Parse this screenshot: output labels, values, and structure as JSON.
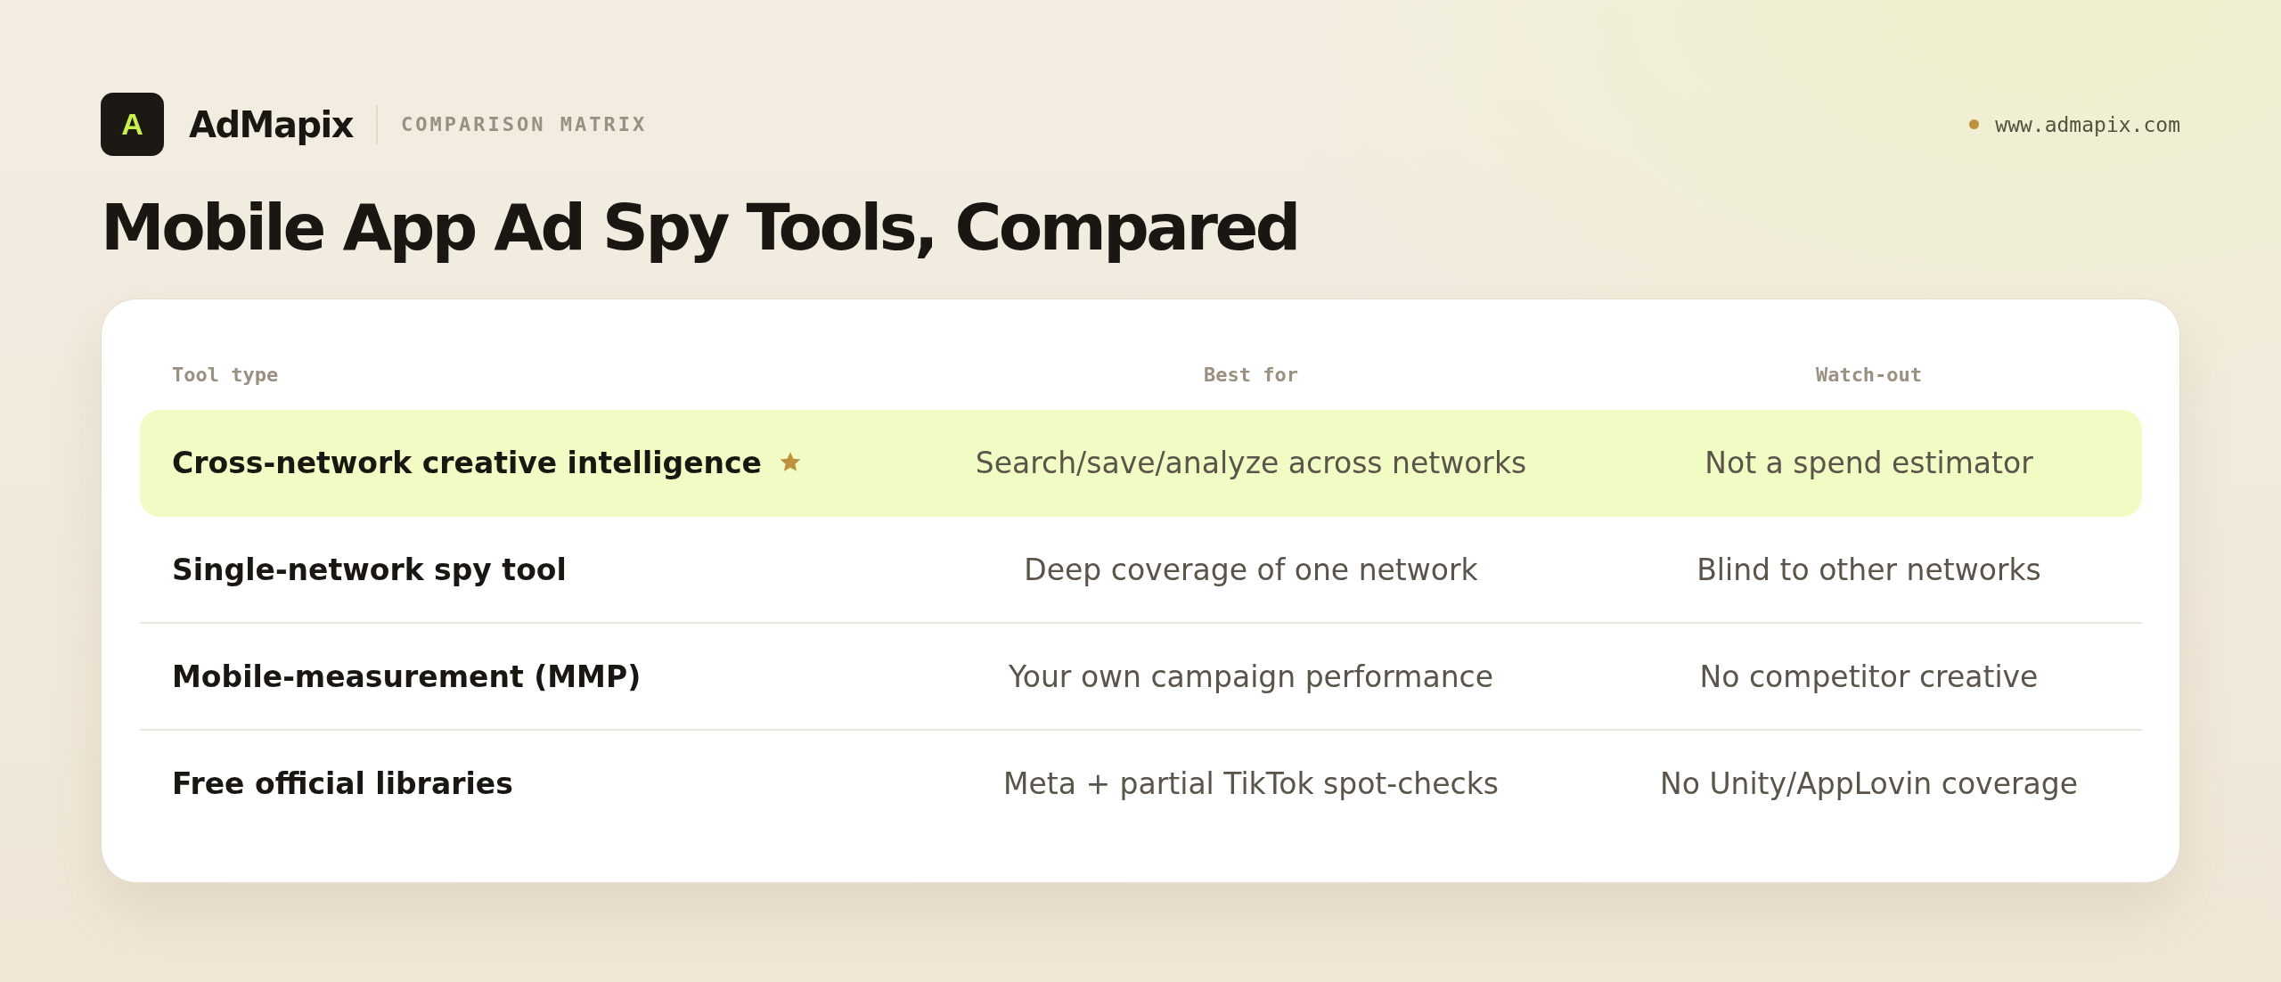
{
  "brand": {
    "logo_letter": "A",
    "name": "AdMapix",
    "tagline": "COMPARISON MATRIX",
    "website": "www.admapix.com"
  },
  "title": "Mobile App Ad Spy Tools, Compared",
  "table": {
    "columns": [
      "Tool type",
      "Best for",
      "Watch-out"
    ],
    "rows": [
      {
        "cells": [
          "Cross-network creative intelligence",
          "Search/save/analyze across networks",
          "Not a spend estimator"
        ],
        "highlighted": true
      },
      {
        "cells": [
          "Single-network spy tool",
          "Deep coverage of one network",
          "Blind to other networks"
        ],
        "highlighted": false
      },
      {
        "cells": [
          "Mobile-measurement (MMP)",
          "Your own campaign performance",
          "No competitor creative"
        ],
        "highlighted": false
      },
      {
        "cells": [
          "Free official libraries",
          "Meta + partial TikTok spot-checks",
          "No Unity/AppLovin coverage"
        ],
        "highlighted": false
      }
    ]
  }
}
